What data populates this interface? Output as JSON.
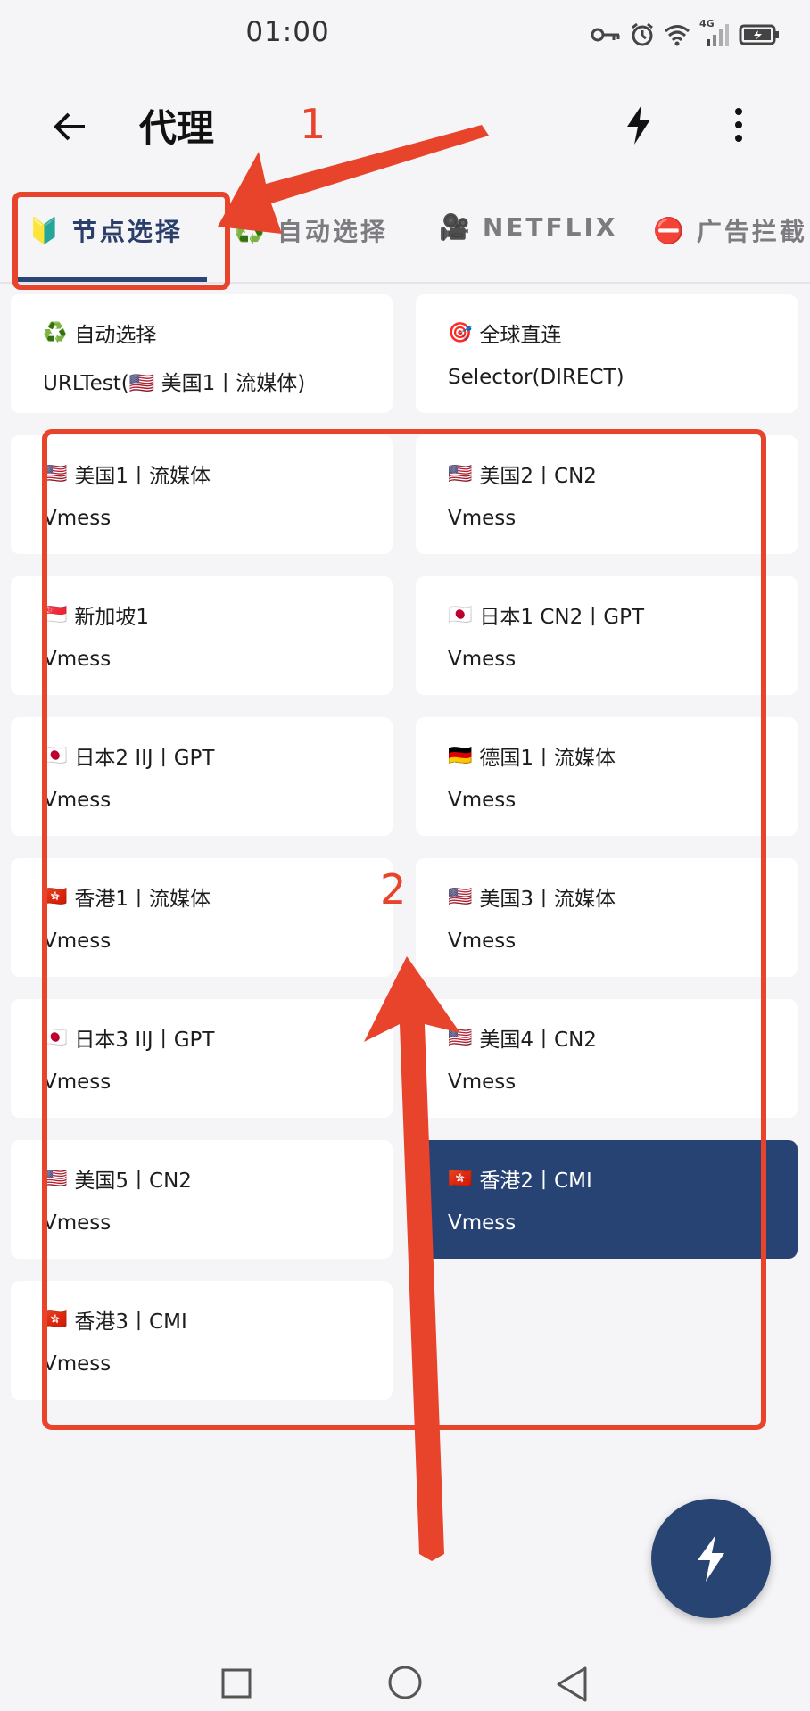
{
  "status_bar": {
    "time": "01:00",
    "icons": [
      "key-icon",
      "alarm-icon",
      "wifi-icon",
      "signal-4g-icon",
      "battery-icon"
    ],
    "network_label": "4G"
  },
  "app_bar": {
    "title": "代理",
    "back_icon": "arrow-back-icon",
    "flash_icon": "lightning-icon",
    "more_icon": "more-vert-icon"
  },
  "tabs": [
    {
      "emoji": "🔰",
      "label": "节点选择",
      "active": true
    },
    {
      "emoji": "♻️",
      "label": "自动选择",
      "active": false
    },
    {
      "emoji": "🎥",
      "label": "NETFLIX",
      "active": false
    },
    {
      "emoji": "⛔",
      "label": "广告拦截",
      "active": false
    }
  ],
  "cards": [
    {
      "flag": "♻️",
      "name": "自动选择",
      "type": "URLTest(🇺🇸 美国1丨流媒体)",
      "selected": false
    },
    {
      "flag": "🎯",
      "name": "全球直连",
      "type": "Selector(DIRECT)",
      "selected": false
    },
    {
      "flag": "🇺🇸",
      "name": "美国1丨流媒体",
      "type": "Vmess",
      "selected": false
    },
    {
      "flag": "🇺🇸",
      "name": "美国2丨CN2",
      "type": "Vmess",
      "selected": false
    },
    {
      "flag": "🇸🇬",
      "name": "新加坡1",
      "type": "Vmess",
      "selected": false
    },
    {
      "flag": "🇯🇵",
      "name": "日本1 CN2丨GPT",
      "type": "Vmess",
      "selected": false
    },
    {
      "flag": "🇯🇵",
      "name": "日本2 IIJ丨GPT",
      "type": "Vmess",
      "selected": false
    },
    {
      "flag": "🇩🇪",
      "name": "德国1丨流媒体",
      "type": "Vmess",
      "selected": false
    },
    {
      "flag": "🇭🇰",
      "name": "香港1丨流媒体",
      "type": "Vmess",
      "selected": false
    },
    {
      "flag": "🇺🇸",
      "name": "美国3丨流媒体",
      "type": "Vmess",
      "selected": false
    },
    {
      "flag": "🇯🇵",
      "name": "日本3 IIJ丨GPT",
      "type": "Vmess",
      "selected": false
    },
    {
      "flag": "🇺🇸",
      "name": "美国4丨CN2",
      "type": "Vmess",
      "selected": false
    },
    {
      "flag": "🇺🇸",
      "name": "美国5丨CN2",
      "type": "Vmess",
      "selected": false
    },
    {
      "flag": "🇭🇰",
      "name": "香港2丨CMI",
      "type": "Vmess",
      "selected": true
    },
    {
      "flag": "🇭🇰",
      "name": "香港3丨CMI",
      "type": "Vmess",
      "selected": false
    }
  ],
  "annotations": {
    "label_1": "1",
    "label_2": "2",
    "color": "#e8432b"
  },
  "fab": {
    "icon": "lightning-icon"
  },
  "nav_bar": {
    "icons": [
      "square-recents-icon",
      "circle-home-icon",
      "triangle-back-icon"
    ]
  },
  "colors": {
    "primary": "#284472",
    "selected_card": "#274373",
    "background": "#f5f5f7"
  }
}
